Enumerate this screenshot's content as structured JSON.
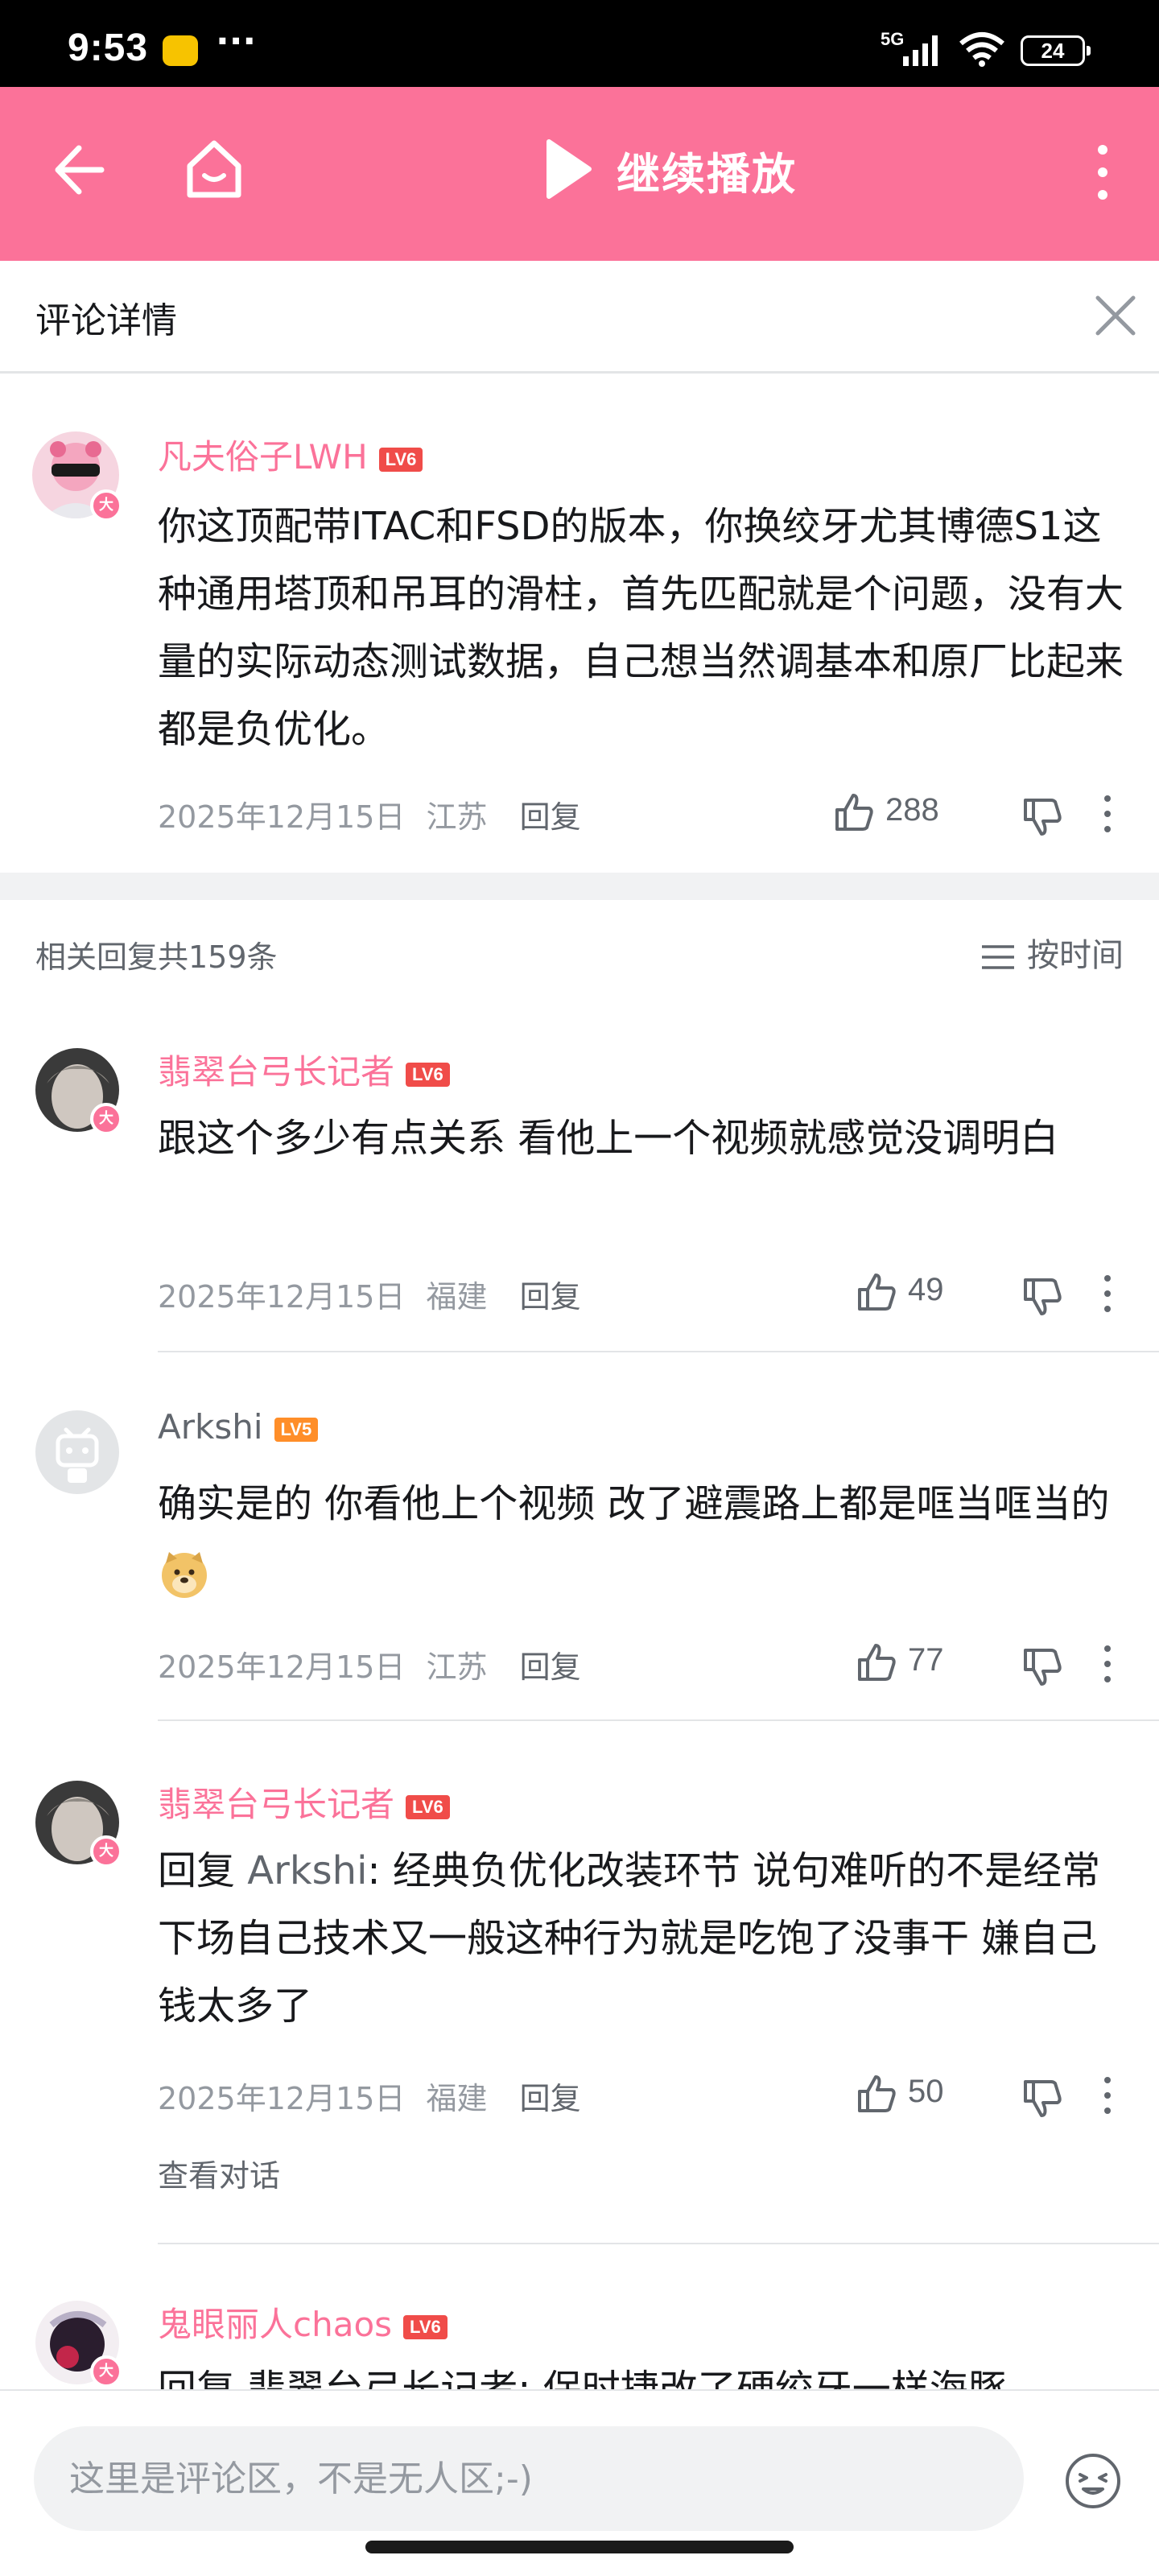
{
  "status_bar": {
    "time": "9:53",
    "more": "···",
    "network": "5G",
    "battery": "24"
  },
  "top_bar": {
    "title": "继续播放"
  },
  "header": {
    "title": "评论详情"
  },
  "main_comment": {
    "username": "凡夫俗子LWH",
    "level": "LV6",
    "text": "你这顶配带ITAC和FSD的版本，你换绞牙尤其博德S1这种通用塔顶和吊耳的滑柱，首先匹配就是个问题，没有大量的实际动态测试数据，自己想当然调基本和原厂比起来都是负优化。",
    "date": "2025年12月15日",
    "location": "江苏",
    "reply_label": "回复",
    "likes": "288"
  },
  "replies_header": {
    "count_label": "相关回复共159条",
    "sort_label": "按时间"
  },
  "replies": [
    {
      "username": "翡翠台弓长记者",
      "level": "LV6",
      "text": "跟这个多少有点关系 看他上一个视频就感觉没调明白",
      "date": "2025年12月15日",
      "location": "福建",
      "reply_label": "回复",
      "likes": "49"
    },
    {
      "username": "Arkshi",
      "level": "LV5",
      "text": "确实是的 你看他上个视频 改了避震路上都是哐当哐当的",
      "date": "2025年12月15日",
      "location": "江苏",
      "reply_label": "回复",
      "likes": "77"
    },
    {
      "username": "翡翠台弓长记者",
      "level": "LV6",
      "reply_prefix": "回复 ",
      "mention": "Arkshi",
      "text": ": 经典负优化改装环节 说句难听的不是经常下场自己技术又一般这种行为就是吃饱了没事干 嫌自己钱太多了",
      "date": "2025年12月15日",
      "location": "福建",
      "reply_label": "回复",
      "likes": "50",
      "view_conversation": "查看对话"
    },
    {
      "username": "鬼眼丽人chaos",
      "level": "LV6",
      "text": "回复 翡翠台弓长记者: 保时捷改了硬绞牙一样海豚"
    }
  ],
  "composer": {
    "placeholder": "这里是评论区，不是无人区;-)"
  },
  "colors": {
    "brand_pink": "#fb7299",
    "text": "#18191c",
    "grey": "#9499a0"
  }
}
